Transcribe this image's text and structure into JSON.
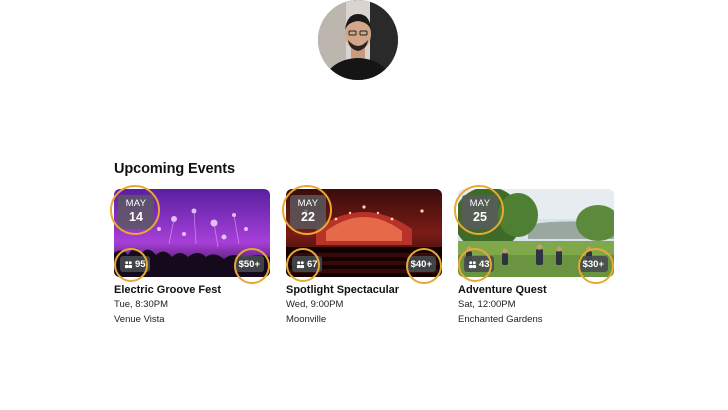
{
  "section": {
    "title": "Upcoming Events"
  },
  "events": [
    {
      "month": "MAY",
      "day": "14",
      "attendees": "95",
      "price": "$50+",
      "title": "Electric Groove Fest",
      "time": "Tue, 8:30PM",
      "venue": "Venue Vista"
    },
    {
      "month": "MAY",
      "day": "22",
      "attendees": "67",
      "price": "$40+",
      "title": "Spotlight Spectacular",
      "time": "Wed, 9:00PM",
      "venue": "Moonville"
    },
    {
      "month": "MAY",
      "day": "25",
      "attendees": "43",
      "price": "$30+",
      "title": "Adventure Quest",
      "time": "Sat, 12:00PM",
      "venue": "Enchanted Gardens"
    }
  ],
  "colors": {
    "highlight_ring": "#e8a832",
    "badge_bg": "#464b4e"
  }
}
